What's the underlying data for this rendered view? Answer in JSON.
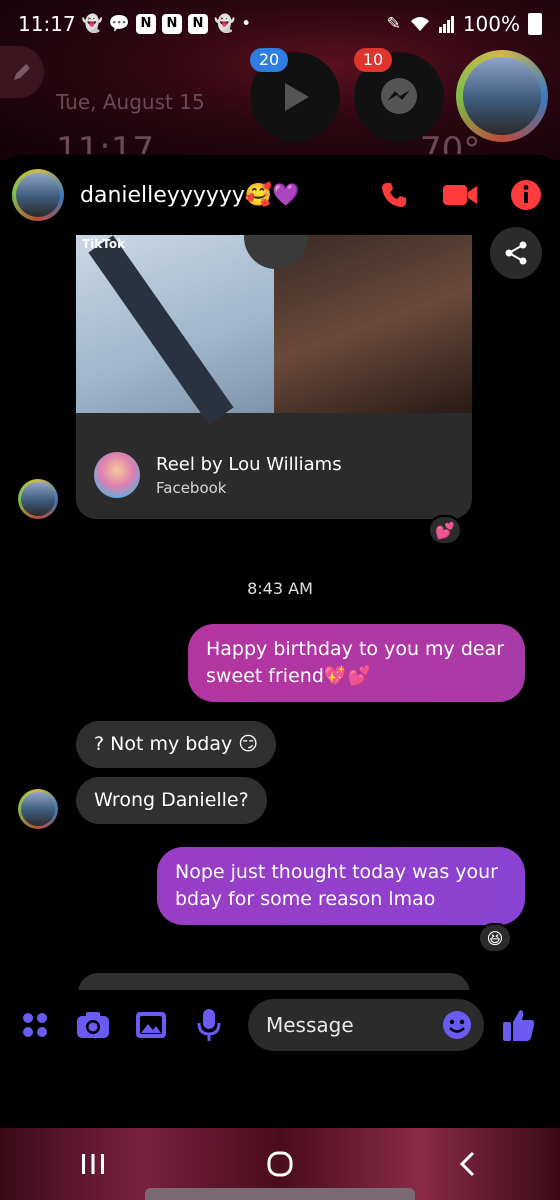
{
  "status_bar": {
    "time": "11:17",
    "battery": "100%"
  },
  "lockscreen": {
    "date": "Tue, August 15",
    "time": "11:17",
    "temperature": "70°"
  },
  "chat_heads": [
    {
      "badge": "20",
      "badge_color": "#2f7de1",
      "icon": "play-icon"
    },
    {
      "badge": "10",
      "badge_color": "#e0352f",
      "icon": "messenger-icon"
    }
  ],
  "header": {
    "contact_name": "danielleyyyyyy🥰💜",
    "accent": "#ff3b3b"
  },
  "reel_card": {
    "watermark": "TikTok",
    "title": "Reel by Lou Williams",
    "source": "Facebook",
    "reaction": "💕"
  },
  "timestamp": "8:43 AM",
  "messages": [
    {
      "direction": "out",
      "text": "Happy birthday to you my dear sweet friend💖💕"
    },
    {
      "direction": "in",
      "text": "? Not my bday 😏"
    },
    {
      "direction": "in",
      "text": "Wrong Danielle?"
    },
    {
      "direction": "out",
      "text": "Nope just thought today was your bday for some reason lmao",
      "reaction": "😆"
    }
  ],
  "composer": {
    "placeholder": "Message",
    "accent": "#6a5cf0"
  },
  "colors": {
    "outgoing_bubble_1": "#b0379f",
    "outgoing_bubble_2": "#8e3fcf",
    "incoming_bubble": "#303030"
  }
}
